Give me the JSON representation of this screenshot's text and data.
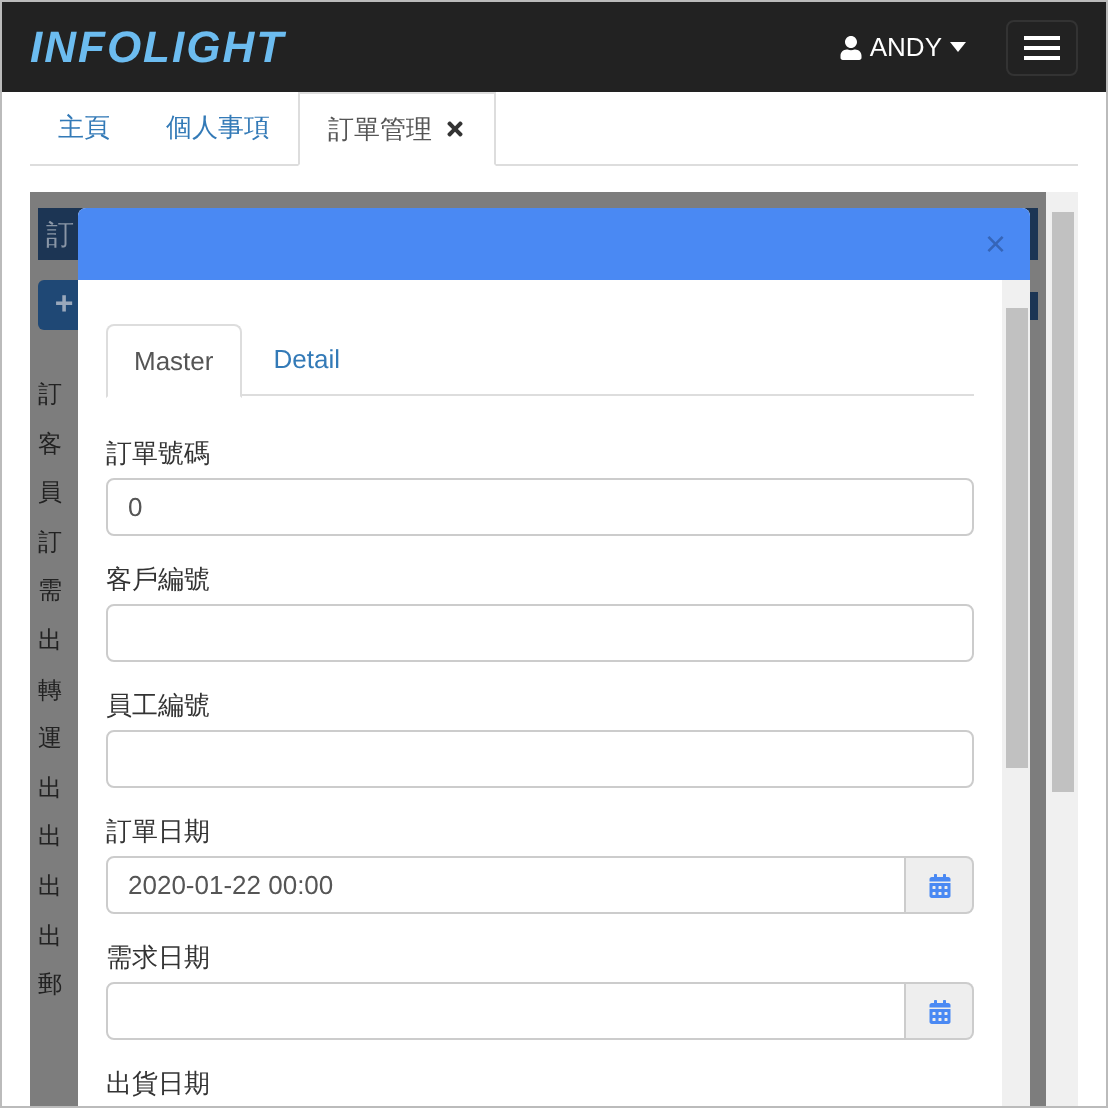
{
  "navbar": {
    "logo": "INFOLIGHT",
    "user": "ANDY"
  },
  "tabs": [
    {
      "label": "主頁",
      "selected": false,
      "closable": false
    },
    {
      "label": "個人事項",
      "selected": false,
      "closable": false
    },
    {
      "label": "訂單管理",
      "selected": true,
      "closable": true
    }
  ],
  "background_page": {
    "header": "訂",
    "add_button": "+",
    "labels": [
      "訂",
      "客",
      "員",
      "訂",
      "需",
      "出",
      "轉",
      "運",
      "出",
      "出",
      "出",
      "出",
      "郵"
    ]
  },
  "dialog": {
    "close": "×",
    "tabs": [
      {
        "label": "Master",
        "selected": true
      },
      {
        "label": "Detail",
        "selected": false
      }
    ],
    "fields": [
      {
        "label": "訂單號碼",
        "kind": "text",
        "value": "0"
      },
      {
        "label": "客戶編號",
        "kind": "text"
      },
      {
        "label": "員工編號",
        "kind": "text"
      },
      {
        "label": "訂單日期",
        "kind": "date",
        "value": "2020-01-22 00:00"
      },
      {
        "label": "需求日期",
        "kind": "date"
      },
      {
        "label": "出貨日期",
        "kind": "label_only"
      }
    ]
  }
}
